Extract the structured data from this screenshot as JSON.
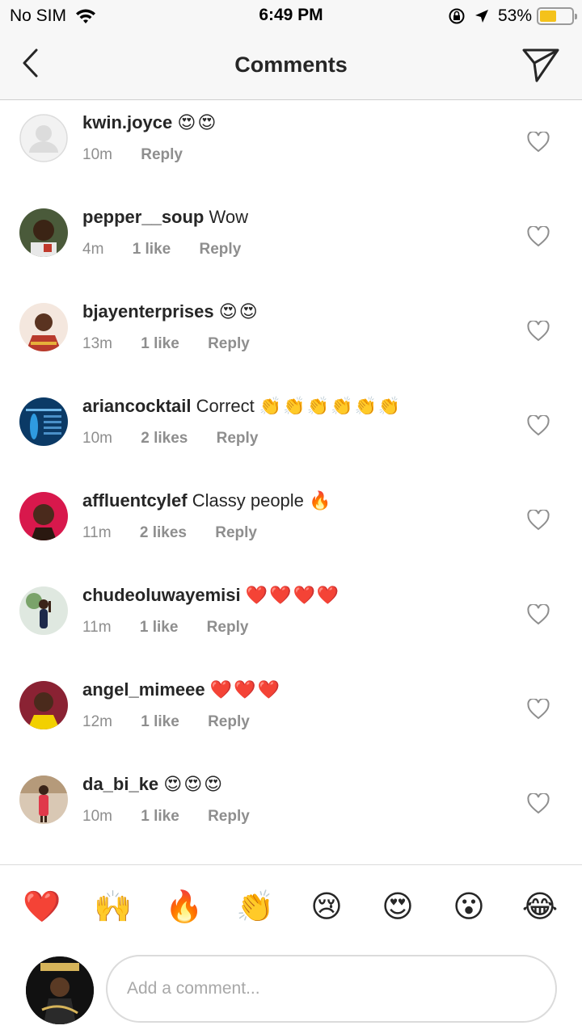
{
  "status_bar": {
    "carrier": "No SIM",
    "time": "6:49 PM",
    "battery_percent": "53%",
    "battery_level": 0.53,
    "icons": [
      "wifi-icon",
      "orientation-lock-icon",
      "location-arrow-icon",
      "battery-icon"
    ]
  },
  "header": {
    "title": "Comments",
    "back_icon": "chevron-left-icon",
    "share_icon": "paper-plane-icon"
  },
  "comments": [
    {
      "username": "kwin.joyce",
      "text": "",
      "emoji": "😍😍",
      "time": "10m",
      "likes": "",
      "reply": "Reply"
    },
    {
      "username": "pepper__soup",
      "text": "Wow",
      "emoji": "",
      "time": "4m",
      "likes": "1 like",
      "reply": "Reply"
    },
    {
      "username": "bjayenterprises",
      "text": "",
      "emoji": "😍😍",
      "time": "13m",
      "likes": "1 like",
      "reply": "Reply"
    },
    {
      "username": "ariancocktail",
      "text": "Correct",
      "emoji": "👏👏👏👏👏👏",
      "time": "10m",
      "likes": "2 likes",
      "reply": "Reply"
    },
    {
      "username": "affluentcylef",
      "text": "Classy people",
      "emoji": "🔥",
      "time": "11m",
      "likes": "2 likes",
      "reply": "Reply"
    },
    {
      "username": "chudeoluwayemisi",
      "text": "",
      "emoji": "❤️❤️❤️❤️",
      "time": "11m",
      "likes": "1 like",
      "reply": "Reply"
    },
    {
      "username": "angel_mimeee",
      "text": "",
      "emoji": "❤️❤️❤️",
      "time": "12m",
      "likes": "1 like",
      "reply": "Reply"
    },
    {
      "username": "da_bi_ke",
      "text": "",
      "emoji": "😍😍😍",
      "time": "10m",
      "likes": "1 like",
      "reply": "Reply"
    }
  ],
  "reactions": [
    "❤️",
    "🙌",
    "🔥",
    "👏",
    "😢",
    "😍",
    "😮",
    "😂"
  ],
  "composer": {
    "placeholder": "Add a comment..."
  },
  "colors": {
    "text": "#262626",
    "meta": "#8e8e8e",
    "battery": "#f4c21b",
    "header_bg": "#f7f7f7"
  }
}
